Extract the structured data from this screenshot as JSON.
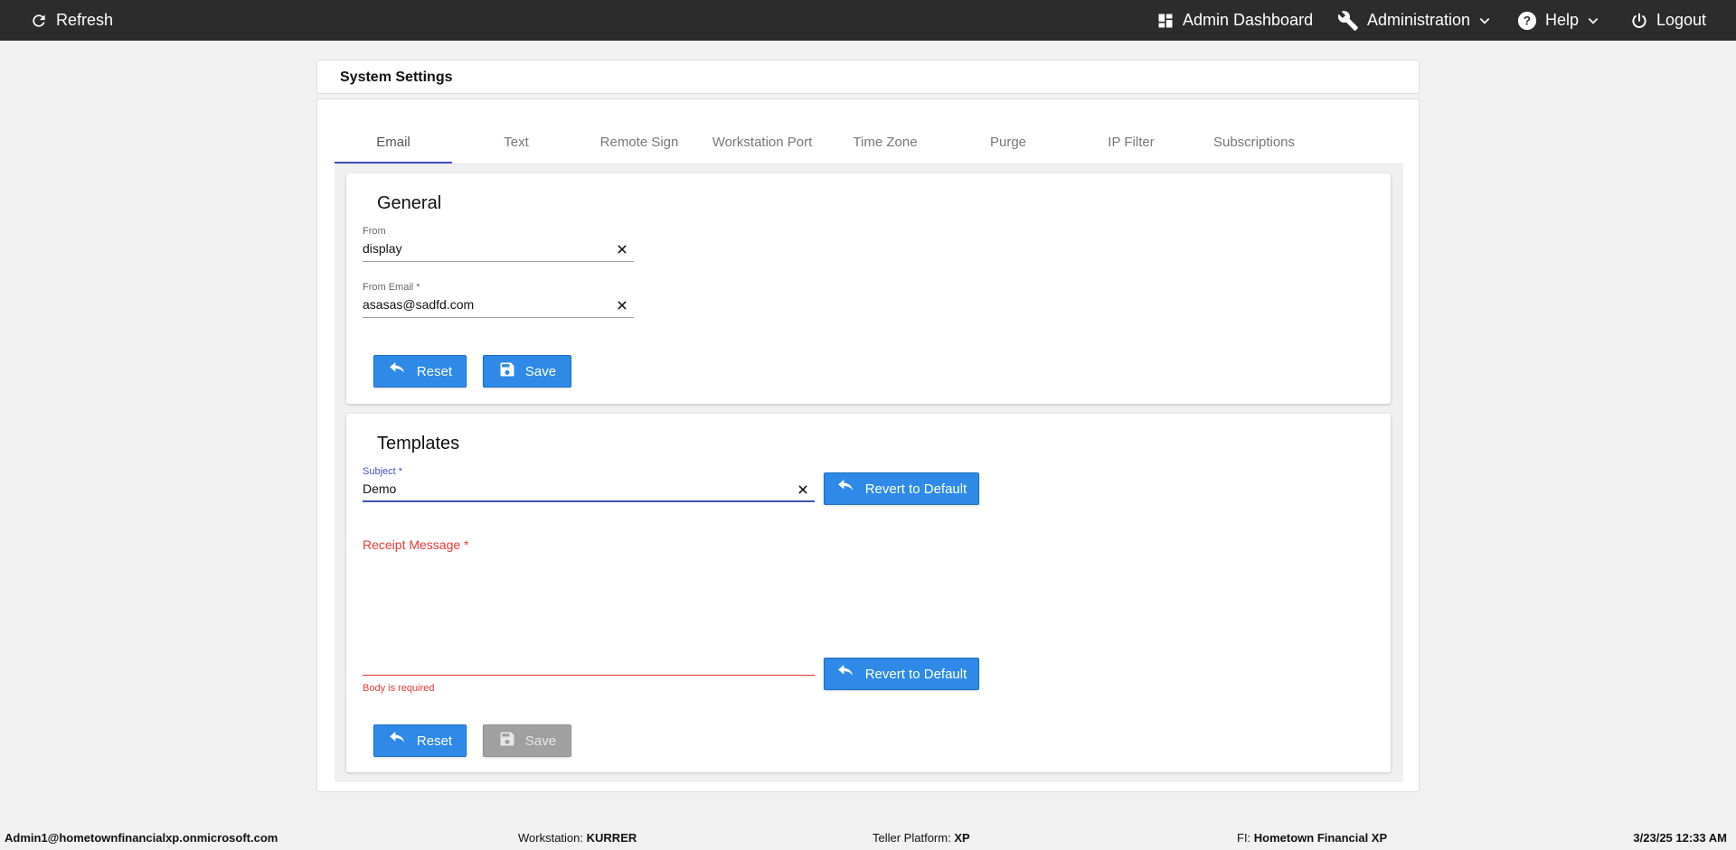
{
  "topbar": {
    "refresh_label": "Refresh",
    "admin_dashboard_label": "Admin Dashboard",
    "administration_label": "Administration",
    "help_label": "Help",
    "logout_label": "Logout"
  },
  "page": {
    "title": "System Settings"
  },
  "tabs": [
    {
      "label": "Email",
      "active": true
    },
    {
      "label": "Text"
    },
    {
      "label": "Remote Sign"
    },
    {
      "label": "Workstation Port"
    },
    {
      "label": "Time Zone"
    },
    {
      "label": "Purge"
    },
    {
      "label": "IP Filter"
    },
    {
      "label": "Subscriptions"
    }
  ],
  "general": {
    "title": "General",
    "from_label": "From",
    "from_value": "display",
    "from_email_label": "From Email *",
    "from_email_value": "asasas@sadfd.com",
    "reset_label": "Reset",
    "save_label": "Save"
  },
  "templates": {
    "title": "Templates",
    "subject_label": "Subject *",
    "subject_value": "Demo",
    "revert_label": "Revert to Default",
    "receipt_label": "Receipt Message *",
    "receipt_value": "",
    "receipt_error": "Body is required",
    "revert_label_2": "Revert to Default",
    "reset_label": "Reset",
    "save_label": "Save"
  },
  "footer": {
    "user": "Admin1@hometownfinancialxp.onmicrosoft.com",
    "workstation_label": "Workstation:",
    "workstation_value": "KURRER",
    "teller_label": "Teller Platform:",
    "teller_value": "XP",
    "fi_label": "FI:",
    "fi_value": "Hometown Financial XP",
    "datetime": "3/23/25 12:33 AM"
  },
  "colors": {
    "topbar": "#2c2c2c",
    "primary_button": "#2e8ae6",
    "tab_ink": "#3f51b5",
    "error": "#e53935",
    "focus": "#3f51b5"
  },
  "icons": {
    "refresh": "refresh-icon",
    "dashboard": "dashboard-icon",
    "administration": "wrench-icon",
    "help": "help-circle-icon",
    "logout": "power-icon",
    "clear": "close-icon",
    "undo": "undo-icon",
    "save": "floppy-disk-icon"
  }
}
